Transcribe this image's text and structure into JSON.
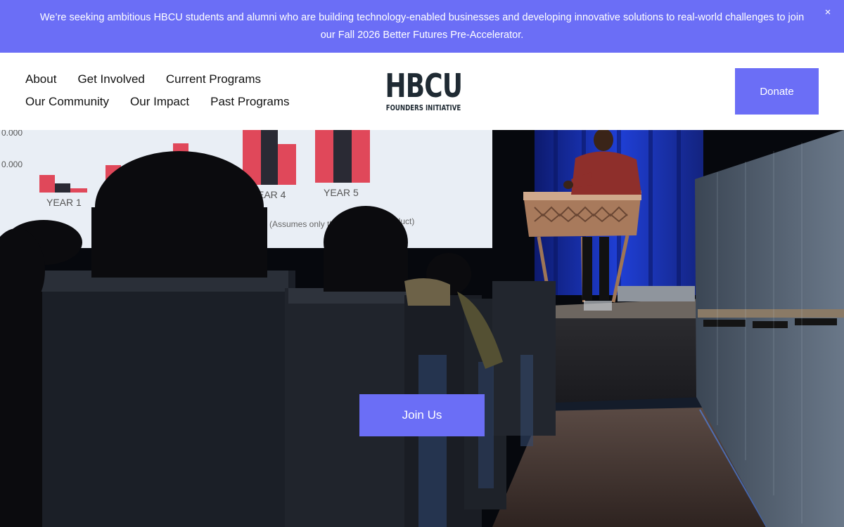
{
  "announcement": {
    "text": "We’re seeking ambitious HBCU students and alumni who are building technology-enabled businesses and developing innovative solutions to real-world challenges to join our Fall 2026 Better Futures Pre-Accelerator.",
    "close_icon": "×"
  },
  "nav": {
    "row1": [
      "About",
      "Get Involved",
      "Current Programs"
    ],
    "row2": [
      "Our Community",
      "Our Impact",
      "Past Programs"
    ]
  },
  "logo": {
    "main": "HBCU",
    "sub": "FOUNDERS INITIATIVE"
  },
  "header": {
    "donate_label": "Donate"
  },
  "hero": {
    "cta_label": "Join Us",
    "image_alt": "Speaker at a podium presenting a bar chart to an audience",
    "screen_text": {
      "y_tick_1": "0.000",
      "y_tick_2": "0.000",
      "x_year1": "YEAR 1",
      "x_year4": "EAR 4",
      "x_year5": "YEAR 5",
      "note_left": "(Assumes only th",
      "note_right": "oduct)"
    }
  },
  "colors": {
    "accent": "#6b6ef6",
    "logo": "#1f2a33",
    "stage_curtain": "#1f3fd6",
    "chart_red": "#e0485a",
    "chart_dark": "#2a2a34"
  }
}
